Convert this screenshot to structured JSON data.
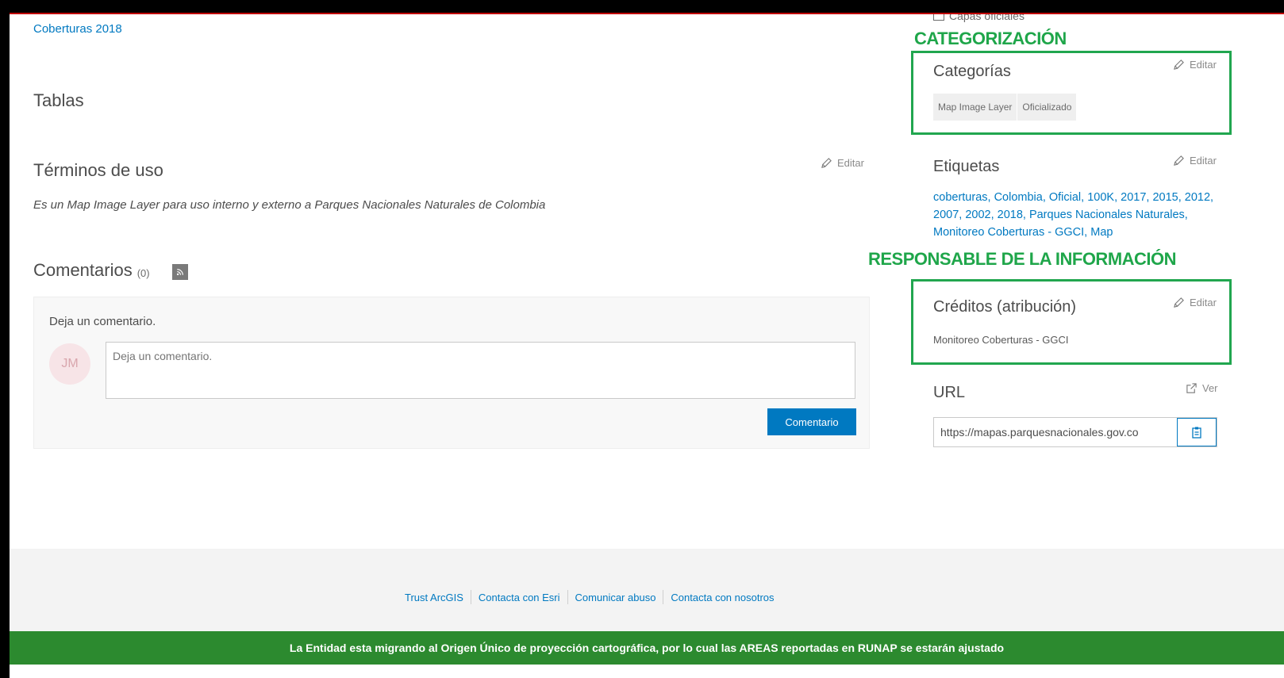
{
  "top_link": "Coberturas 2018",
  "capas_label": "Capas oficiales",
  "left": {
    "tablas_title": "Tablas",
    "terminos": {
      "title": "Términos de uso",
      "edit_label": "Editar",
      "text": "Es un Map Image Layer para uso interno y externo a Parques Nacionales Naturales de Colombia"
    },
    "comentarios": {
      "title": "Comentarios",
      "count": "(0)",
      "prompt": "Deja un comentario.",
      "avatar_initials": "JM",
      "placeholder": "Deja un comentario.",
      "submit_label": "Comentario"
    }
  },
  "right": {
    "annotation_categorizacion": "CATEGORIZACIÓN",
    "categorias": {
      "title": "Categorías",
      "edit_label": "Editar",
      "chips": [
        "Map Image Layer",
        "Oficializado"
      ]
    },
    "etiquetas": {
      "title": "Etiquetas",
      "edit_label": "Editar",
      "tags_text": "coberturas, Colombia, Oficial, 100K, 2017, 2015, 2012, 2007, 2002, 2018, Parques Nacionales Naturales, Monitoreo Coberturas - GGCI, Map"
    },
    "annotation_responsable": "RESPONSABLE DE LA INFORMACIÓN",
    "creditos": {
      "title": "Créditos (atribución)",
      "edit_label": "Editar",
      "text": "Monitoreo Coberturas - GGCI"
    },
    "url": {
      "title": "URL",
      "view_label": "Ver",
      "value": "https://mapas.parquesnacionales.gov.co"
    }
  },
  "footer": {
    "links": [
      "Trust ArcGIS",
      "Contacta con Esri",
      "Comunicar abuso",
      "Contacta con nosotros"
    ],
    "banner_text": "La Entidad esta migrando al Origen Único de proyección cartográfica, por lo cual las AREAS reportadas en RUNAP se estarán ajustado"
  },
  "colors": {
    "link": "#0079c1",
    "annotation_green": "#1fa64a",
    "banner_green": "#2c8a2f",
    "top_border_red": "#c00000"
  }
}
